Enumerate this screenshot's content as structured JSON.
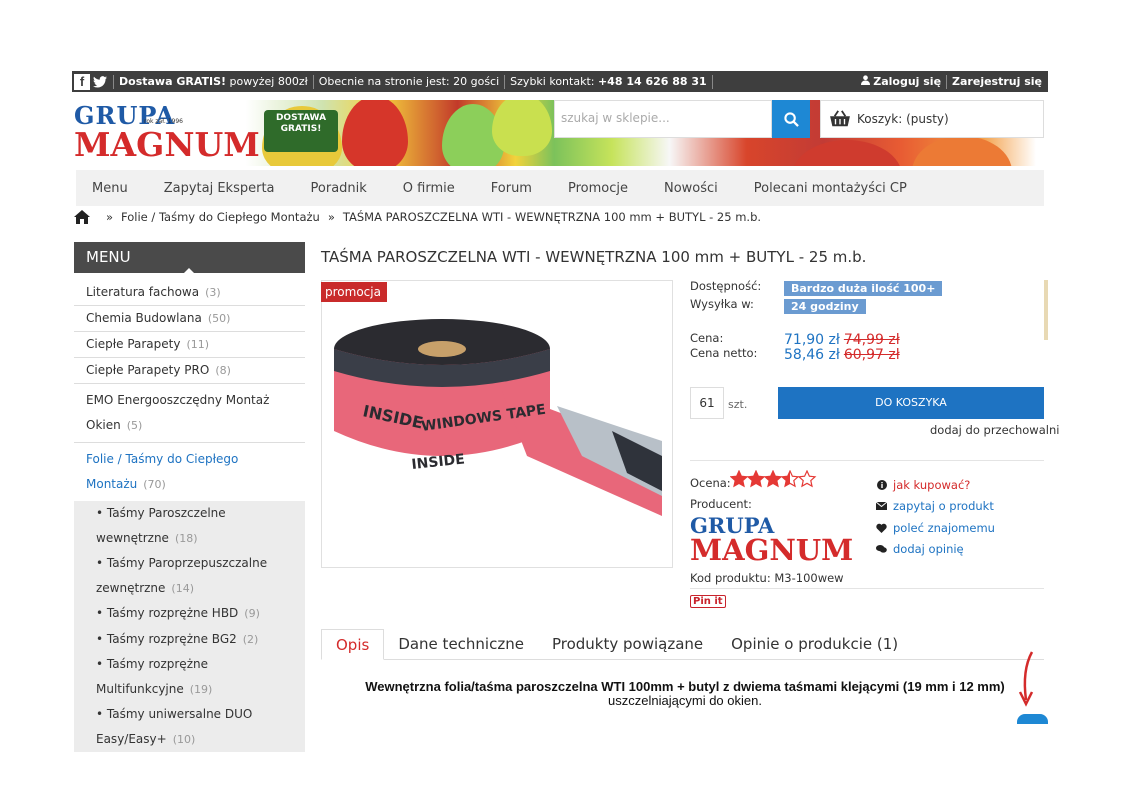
{
  "topbar": {
    "facebook_icon": "f",
    "delivery_bold": "Dostawa GRATIS!",
    "delivery_rest": "powyżej 800zł",
    "online": "Obecnie na stronie jest: 20 gości",
    "contact_label": "Szybki kontakt:",
    "contact_phone": "+48 14 626 88 31",
    "login": "Zaloguj się",
    "register": "Zarejestruj się"
  },
  "header": {
    "logo_line1": "GRUPA",
    "logo_line2": "MAGNUM",
    "logo_est": "rok zał. 1996",
    "truck_line1": "DOSTAWA",
    "truck_line2": "GRATIS!",
    "search_placeholder": "szukaj w sklepie...",
    "cart_label": "Koszyk: (pusty)"
  },
  "nav": [
    "Menu",
    "Zapytaj Eksperta",
    "Poradnik",
    "O firmie",
    "Forum",
    "Promocje",
    "Nowości",
    "Polecani montażyści CP"
  ],
  "breadcrumb": {
    "sep": "»",
    "category": "Folie / Taśmy do Ciepłego Montażu",
    "current": "TAŚMA PAROSZCZELNA WTI - WEWNĘTRZNA 100 mm + BUTYL - 25 m.b."
  },
  "sidebar": {
    "header": "MENU",
    "items": [
      {
        "label": "Literatura fachowa",
        "count": "(3)"
      },
      {
        "label": "Chemia Budowlana",
        "count": "(50)"
      },
      {
        "label": "Ciepłe Parapety",
        "count": "(11)"
      },
      {
        "label": "Ciepłe Parapety PRO",
        "count": "(8)"
      },
      {
        "label": "EMO Energooszczędny Montaż Okien",
        "count": "(5)"
      },
      {
        "label": "Folie / Taśmy do Ciepłego Montażu",
        "count": "(70)"
      }
    ],
    "subitems": [
      {
        "label": "• Taśmy Paroszczelne wewnętrzne",
        "count": "(18)"
      },
      {
        "label": "• Taśmy Paroprzepuszczalne zewnętrzne",
        "count": "(14)"
      },
      {
        "label": "• Taśmy rozprężne HBD",
        "count": "(9)"
      },
      {
        "label": "• Taśmy rozprężne BG2",
        "count": "(2)"
      },
      {
        "label": "• Taśmy rozprężne Multifunkcyjne",
        "count": "(19)"
      },
      {
        "label": "• Taśmy uniwersalne DUO Easy/Easy+",
        "count": "(10)"
      }
    ]
  },
  "product": {
    "title": "TAŚMA PAROSZCZELNA WTI - WEWNĘTRZNA 100 mm + BUTYL - 25 m.b.",
    "promo": "promocja",
    "image_text": [
      "INSIDE",
      "WINDOWS TAPE",
      "INSIDE"
    ],
    "availability_label": "Dostępność:",
    "availability_value": "Bardzo duża ilość 100+",
    "shipping_label": "Wysyłka w:",
    "shipping_value": "24 godziny",
    "price_label": "Cena:",
    "price": "71,90 zł",
    "price_old": "74,99 zł",
    "net_label": "Cena netto:",
    "net_price": "58,46 zł",
    "net_old": "60,97 zł",
    "qty": "61",
    "qty_unit": "szt.",
    "add_to_cart": "DO KOSZYKA",
    "wishlist": "dodaj do przechowalni",
    "rating_label": "Ocena:",
    "rating": 3.5,
    "producer_label": "Producent:",
    "producer_line1": "GRUPA",
    "producer_line2": "MAGNUM",
    "code_label": "Kod produktu:",
    "code_value": "M3-100wew",
    "pin": "Pin it",
    "links": [
      {
        "icon": "info-icon",
        "label": "jak kupować?"
      },
      {
        "icon": "envelope-icon",
        "label": "zapytaj o produkt"
      },
      {
        "icon": "heart-icon",
        "label": "poleć znajomemu"
      },
      {
        "icon": "comments-icon",
        "label": "dodaj opinię"
      }
    ]
  },
  "tabs": [
    "Opis",
    "Dane techniczne",
    "Produkty powiązane",
    "Opinie o produkcie (1)"
  ],
  "description": {
    "bold": "Wewnętrzna folia/taśma paroszczelna WTI 100mm + butyl z dwiema taśmami klejącymi (19 mm i 12 mm)",
    "rest": "uszczelniającymi do okien."
  },
  "colors": {
    "accent": "#1e73c2",
    "red": "#d42b2b",
    "dark": "#3e3e3e"
  }
}
